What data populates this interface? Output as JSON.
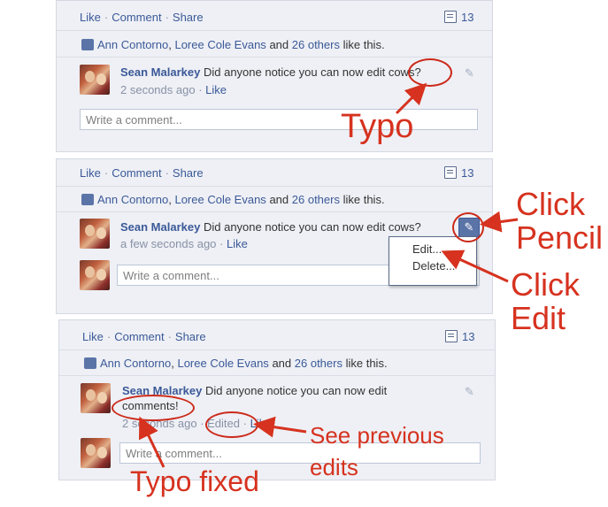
{
  "panel1": {
    "actions": [
      "Like",
      "Comment",
      "Share"
    ],
    "comment_count": "13",
    "likes": {
      "name1": "Ann Contorno",
      "name2": "Loree Cole Evans",
      "and": "and",
      "others": "26 others",
      "suffix": "like this."
    },
    "comment": {
      "author": "Sean Malarkey",
      "text": "Did anyone notice you can now edit cows?",
      "time": "2 seconds ago",
      "like": "Like"
    },
    "input_placeholder": "Write a comment..."
  },
  "panel2": {
    "actions": [
      "Like",
      "Comment",
      "Share"
    ],
    "comment_count": "13",
    "likes": {
      "name1": "Ann Contorno",
      "name2": "Loree Cole Evans",
      "and": "and",
      "others": "26 others",
      "suffix": "like this."
    },
    "comment": {
      "author": "Sean Malarkey",
      "text": "Did anyone notice you can now edit cows?",
      "time": "a few seconds ago",
      "like": "Like"
    },
    "menu": [
      "Edit...",
      "Delete..."
    ],
    "input_placeholder": "Write a comment..."
  },
  "panel3": {
    "actions": [
      "Like",
      "Comment",
      "Share"
    ],
    "comment_count": "13",
    "likes": {
      "name1": "Ann Contorno",
      "name2": "Loree Cole Evans",
      "and": "and",
      "others": "26 others",
      "suffix": "like this."
    },
    "comment": {
      "author": "Sean Malarkey",
      "text": "Did anyone notice you can now edit comments!",
      "time": "2 seconds ago",
      "edited": "Edited",
      "like": "Like"
    },
    "input_placeholder": "Write a comment..."
  },
  "annotations": {
    "typo": "Typo",
    "click_pencil": [
      "Click",
      "Pencil"
    ],
    "click_edit": [
      "Click",
      "Edit"
    ],
    "see_previous": [
      "See previous",
      "edits"
    ],
    "typo_fixed": "Typo fixed"
  },
  "colors": {
    "link": "#3b5998",
    "annotation": "#d6321f",
    "panel_bg": "#eef0f5"
  },
  "icons": {
    "comment_count": "comment-count-icon",
    "thumb": "thumbs-up-icon",
    "pencil": "pencil-icon"
  }
}
